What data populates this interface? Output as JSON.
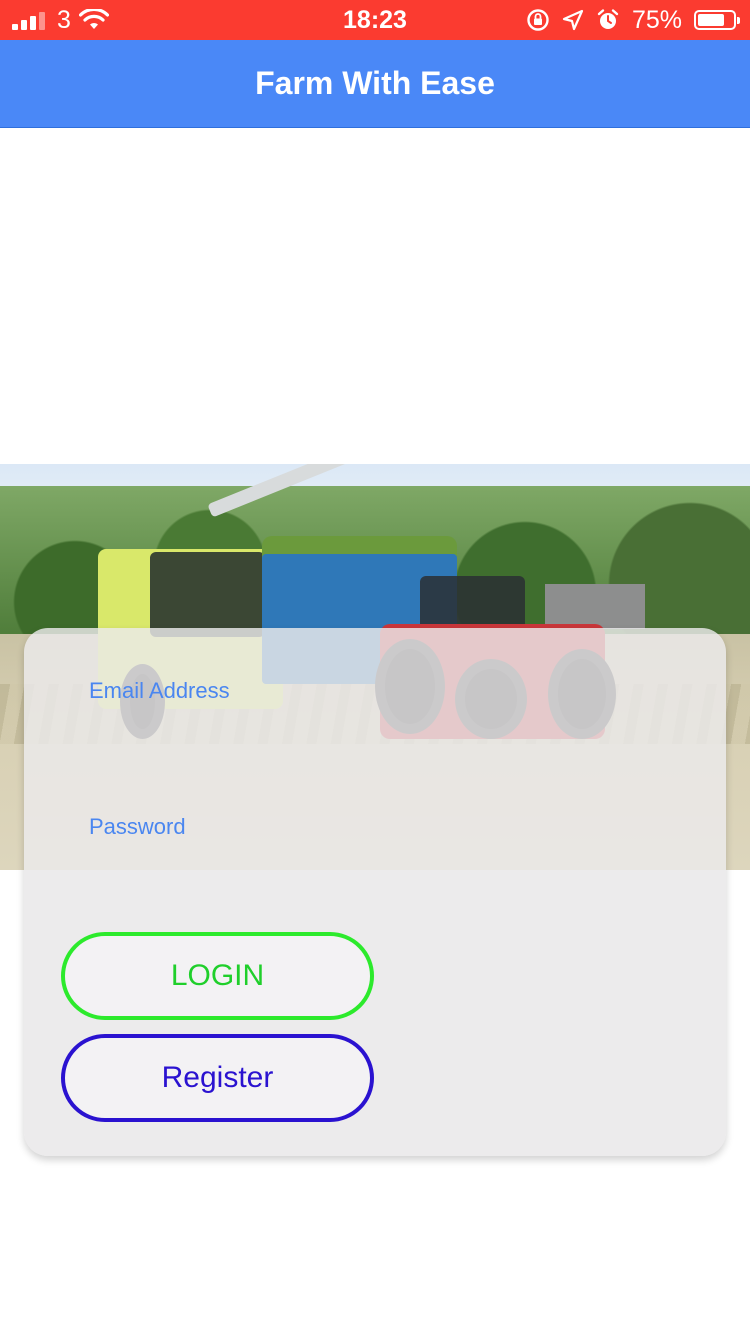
{
  "status_bar": {
    "carrier": "3",
    "time": "18:23",
    "battery_percent": "75%",
    "battery_level": 0.75,
    "background_color": "#fb3b30",
    "icons": [
      "signal-icon",
      "wifi-icon",
      "orientation-lock-icon",
      "location-icon",
      "alarm-icon",
      "battery-icon"
    ]
  },
  "nav": {
    "title": "Farm With Ease",
    "background_color": "#4a88f7"
  },
  "login_form": {
    "email_label": "Email Address",
    "password_label": "Password",
    "login_button": "LOGIN",
    "register_button": "Register",
    "login_color": "#2cea2c",
    "register_color": "#2a12d0",
    "label_color": "#4a86f0"
  }
}
